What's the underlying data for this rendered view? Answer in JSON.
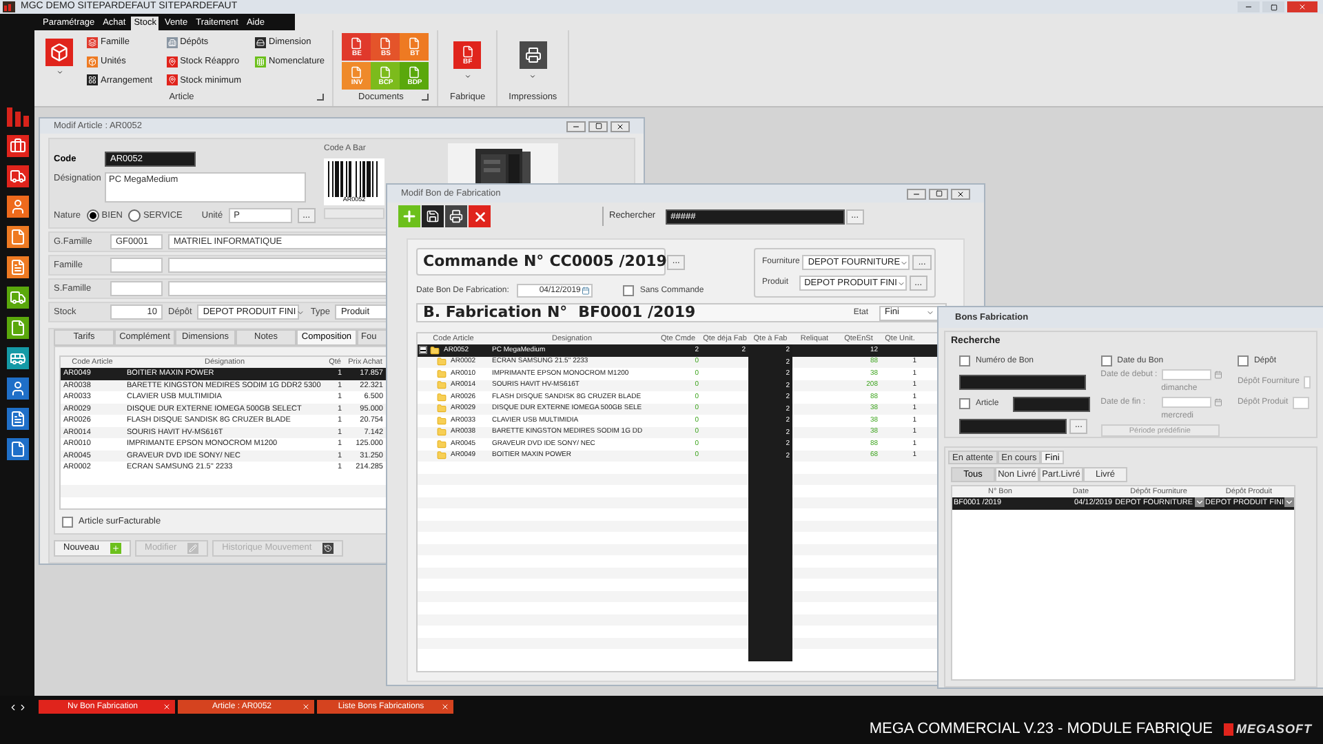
{
  "window": {
    "title": "MGC DEMO SITEPARDEFAUT SITEPARDEFAUT"
  },
  "menu_tabs": [
    {
      "label": "Paramétrage",
      "selected": false
    },
    {
      "label": "Achat",
      "selected": false
    },
    {
      "label": "Stock",
      "selected": true
    },
    {
      "label": "Vente",
      "selected": false
    },
    {
      "label": "Traitement",
      "selected": false
    },
    {
      "label": "Aide",
      "selected": false
    }
  ],
  "ribbon": {
    "article": {
      "label": "Article",
      "items": [
        "Famille",
        "Unités",
        "Arrangement",
        "Dépôts",
        "Stock Réappro",
        "Stock minimum",
        "Dimension",
        "Nomenclature"
      ]
    },
    "documents": {
      "label": "Documents",
      "tiles": [
        {
          "label": "BE",
          "color": "#e0392c"
        },
        {
          "label": "BS",
          "color": "#e4542a"
        },
        {
          "label": "BT",
          "color": "#ee7a22"
        },
        {
          "label": "INV",
          "color": "#ef8a2a"
        },
        {
          "label": "BCP",
          "color": "#7cbb1c"
        },
        {
          "label": "BDP",
          "color": "#5aa80c"
        }
      ]
    },
    "fabrique": {
      "label": "Fabrique",
      "tile": "BF"
    },
    "impressions": {
      "label": "Impressions"
    }
  },
  "article_window": {
    "title": "Modif Article : AR0052",
    "code_label": "Code",
    "code": "AR0052",
    "designation_label": "Désignation",
    "designation": "PC MegaMedium",
    "nature_label": "Nature",
    "nature_options": [
      {
        "label": "BIEN",
        "selected": true
      },
      {
        "label": "SERVICE",
        "selected": false
      }
    ],
    "unite_label": "Unité",
    "unite": "P",
    "unite_browse": "...",
    "barcode_label": "Code A Bar",
    "barcode_text": "AR0052",
    "gfamille_label": "G.Famille",
    "gfamille_code": "GF0001",
    "gfamille_name": "MATRIEL INFORMATIQUE",
    "famille_label": "Famille",
    "sfamille_label": "S.Famille",
    "stock_label": "Stock",
    "stock": "10",
    "depot_label": "Dépôt",
    "depot": "DEPOT PRODUIT FINI",
    "type_label": "Type",
    "type": "Produit",
    "tabs": [
      {
        "label": "Tarifs",
        "selected": false
      },
      {
        "label": "Complément",
        "selected": false
      },
      {
        "label": "Dimensions",
        "selected": false
      },
      {
        "label": "Notes",
        "selected": false
      },
      {
        "label": "Composition",
        "selected": true
      },
      {
        "label": "Fou",
        "selected": false
      }
    ],
    "table": {
      "columns": [
        "Code Article",
        "Désignation",
        "Qté",
        "Prix Achat"
      ],
      "rows": [
        {
          "cells": [
            "AR0049",
            "BOITIER  MAXIN POWER",
            "1",
            "17.857"
          ],
          "selected": true
        },
        {
          "cells": [
            "AR0038",
            "BARETTE KINGSTON MEDIRES SODIM 1G DDR2 5300",
            "1",
            "22.321"
          ],
          "selected": false
        },
        {
          "cells": [
            "AR0033",
            "CLAVIER USB MULTIMIDIA",
            "1",
            "6.500"
          ],
          "selected": false
        },
        {
          "cells": [
            "AR0029",
            "DISQUE DUR EXTERNE IOMEGA 500GB  SELECT",
            "1",
            "95.000"
          ],
          "selected": false
        },
        {
          "cells": [
            "AR0026",
            "FLASH DISQUE SANDISK 8G CRUZER BLADE",
            "1",
            "20.754"
          ],
          "selected": false
        },
        {
          "cells": [
            "AR0014",
            "SOURIS HAVIT HV-MS616T",
            "1",
            "7.142"
          ],
          "selected": false
        },
        {
          "cells": [
            "AR0010",
            "IMPRIMANTE EPSON MONOCROM M1200",
            "1",
            "125.000"
          ],
          "selected": false
        },
        {
          "cells": [
            "AR0045",
            "GRAVEUR DVD IDE SONY/ NEC",
            "1",
            "31.250"
          ],
          "selected": false
        },
        {
          "cells": [
            "AR0002",
            "ECRAN SAMSUNG 21.5''  2233",
            "1",
            "214.285"
          ],
          "selected": false
        }
      ]
    },
    "surfacturable": {
      "label": "Article surFacturable",
      "checked": false
    },
    "buttons": [
      {
        "label": "Nouveau",
        "disabled": false
      },
      {
        "label": "Modifier",
        "disabled": true
      },
      {
        "label": "Historique Mouvement",
        "disabled": true
      }
    ]
  },
  "bon_window": {
    "title": "Modif  Bon de Fabrication",
    "search_label": "Rechercher",
    "search_value": "#####",
    "search_browse": "...",
    "commande_label": "Commande N°",
    "commande": "CC0005 /2019",
    "commande_browse": "...",
    "fourniture_label": "Fourniture",
    "fourniture": "DEPOT FOURNITURE",
    "fourniture_browse": "...",
    "produit_label": "Produit",
    "produit": "DEPOT PRODUIT FINI",
    "produit_browse": "...",
    "date_label": "Date Bon De Fabrication:",
    "date": "04/12/2019",
    "sans_commande": {
      "label": "Sans Commande",
      "checked": false
    },
    "bf_label": "B. Fabrication N°",
    "bf": "BF0001 /2019",
    "etat_label": "Etat",
    "etat": "Fini",
    "table": {
      "columns": [
        "Code Article",
        "Designation",
        "Qte Cmde",
        "Qte déja Fab",
        "Qte à Fab",
        "Reliquat",
        "QteEnSt",
        "Qte Unit."
      ],
      "rows": [
        {
          "code": "AR0052",
          "designation": "PC MegaMedium",
          "qte_cmde": "2",
          "qte_deja_fab": "2",
          "qte_a_fab": "2",
          "qteenst": "12",
          "selected": true,
          "expanded": true,
          "children": [
            {
              "code": "AR0002",
              "designation": "ECRAN SAMSUNG 21.5''  2233",
              "qte_cmde": "0",
              "qte_a_fab": "2",
              "qteenst": "88",
              "qte_unit": "1"
            },
            {
              "code": "AR0010",
              "designation": "IMPRIMANTE EPSON MONOCROM M1200",
              "qte_cmde": "0",
              "qte_a_fab": "2",
              "qteenst": "38",
              "qte_unit": "1"
            },
            {
              "code": "AR0014",
              "designation": "SOURIS HAVIT HV-MS616T",
              "qte_cmde": "0",
              "qte_a_fab": "2",
              "qteenst": "208",
              "qte_unit": "1"
            },
            {
              "code": "AR0026",
              "designation": "FLASH DISQUE SANDISK 8G CRUZER BLADE",
              "qte_cmde": "0",
              "qte_a_fab": "2",
              "qteenst": "88",
              "qte_unit": "1"
            },
            {
              "code": "AR0029",
              "designation": "DISQUE DUR EXTERNE IOMEGA 500GB  SELE",
              "qte_cmde": "0",
              "qte_a_fab": "2",
              "qteenst": "38",
              "qte_unit": "1"
            },
            {
              "code": "AR0033",
              "designation": "CLAVIER USB MULTIMIDIA",
              "qte_cmde": "0",
              "qte_a_fab": "2",
              "qteenst": "38",
              "qte_unit": "1"
            },
            {
              "code": "AR0038",
              "designation": "BARETTE KINGSTON MEDIRES SODIM 1G DD",
              "qte_cmde": "0",
              "qte_a_fab": "2",
              "qteenst": "38",
              "qte_unit": "1"
            },
            {
              "code": "AR0045",
              "designation": "GRAVEUR DVD IDE SONY/ NEC",
              "qte_cmde": "0",
              "qte_a_fab": "2",
              "qteenst": "88",
              "qte_unit": "1"
            },
            {
              "code": "AR0049",
              "designation": "BOITIER  MAXIN POWER",
              "qte_cmde": "0",
              "qte_a_fab": "2",
              "qteenst": "68",
              "qte_unit": "1"
            }
          ]
        }
      ]
    }
  },
  "bons_window": {
    "title": "Bons Fabrication",
    "search_title": "Recherche",
    "numero": {
      "label": "Numéro de Bon",
      "checked": false
    },
    "article": {
      "label": "Article",
      "checked": false
    },
    "article_browse": "...",
    "date_bon": {
      "label": "Date du Bon",
      "checked": false
    },
    "date_debut_label": "Date de debut :",
    "date_debut_day": "dimanche",
    "date_fin_label": "Date de fin :",
    "date_fin_day": "mercredi",
    "periode_button": "Période prédéfinie",
    "depot": {
      "label": "Dépôt",
      "checked": false
    },
    "depot_fourniture_label": "Dépôt Fourniture",
    "depot_produit_label": "Dépôt Produit",
    "status_tabs": [
      {
        "label": "En attente",
        "selected": false
      },
      {
        "label": "En cours",
        "selected": false
      },
      {
        "label": "Fini",
        "selected": true
      }
    ],
    "delivery_tabs": [
      {
        "label": "Tous",
        "selected": true
      },
      {
        "label": "Non Livré",
        "selected": false
      },
      {
        "label": "Part.Livré",
        "selected": false
      },
      {
        "label": "Livré",
        "selected": false
      }
    ],
    "table": {
      "columns": [
        "N° Bon",
        "Date",
        "Dépôt Fourniture",
        "Dépôt Produit"
      ],
      "rows": [
        {
          "cells": [
            "BF0001 /2019",
            "04/12/2019",
            "DEPOT FOURNITURE",
            "DEPOT PRODUIT FINI"
          ],
          "selected": true
        }
      ]
    }
  },
  "taskbar": {
    "tabs": [
      {
        "label": "Nv Bon Fabrication",
        "selected": true
      },
      {
        "label": "Article : AR0052",
        "selected": false
      },
      {
        "label": "Liste Bons Fabrications",
        "selected": false
      }
    ],
    "product_name": "MEGA COMMERCIAL V.23 - MODULE FABRIQUE",
    "logo": "MEGASOFT"
  }
}
